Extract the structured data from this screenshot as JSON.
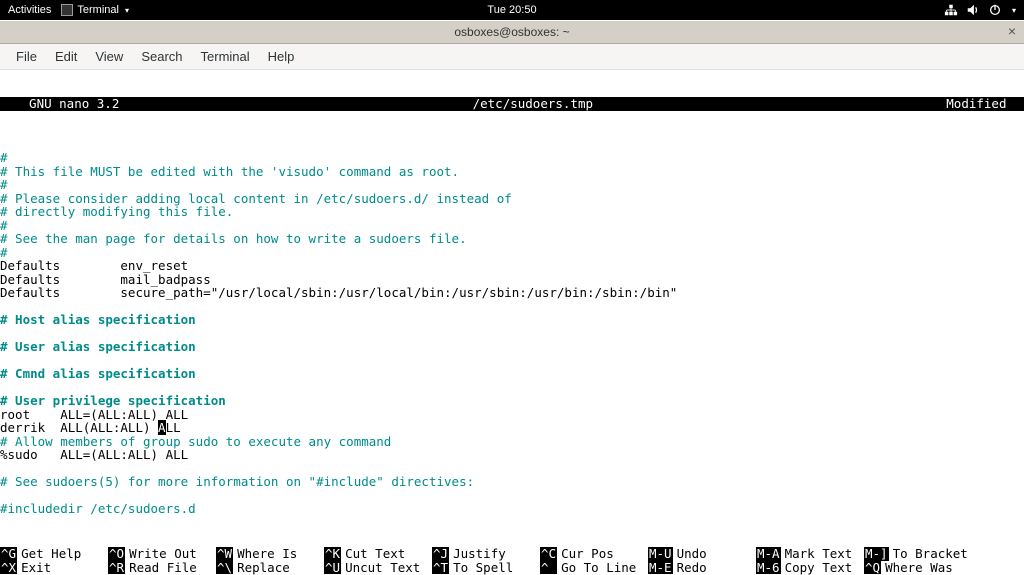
{
  "gnome": {
    "activities": "Activities",
    "app_name": "Terminal",
    "clock": "Tue 20:50"
  },
  "window": {
    "title": "osboxes@osboxes: ~",
    "close": "×"
  },
  "menu": {
    "file": "File",
    "edit": "Edit",
    "view": "View",
    "search": "Search",
    "terminal": "Terminal",
    "help": "Help"
  },
  "nano": {
    "version": "  GNU nano 3.2",
    "filepath": "/etc/sudoers.tmp",
    "modified": "Modified "
  },
  "editor": {
    "l1": "#",
    "l2": "# This file MUST be edited with the 'visudo' command as root.",
    "l3": "#",
    "l4": "# Please consider adding local content in /etc/sudoers.d/ instead of",
    "l5": "# directly modifying this file.",
    "l6": "#",
    "l7": "# See the man page for details on how to write a sudoers file.",
    "l8": "#",
    "l9": "Defaults        env_reset",
    "l10": "Defaults        mail_badpass",
    "l11": "Defaults        secure_path=\"/usr/local/sbin:/usr/local/bin:/usr/sbin:/usr/bin:/sbin:/bin\"",
    "l12": "# Host alias specification",
    "l13": "# User alias specification",
    "l14": "# Cmnd alias specification",
    "l15": "# User privilege specification",
    "l16": "root    ALL=(ALL:ALL) ALL",
    "l17a": "derrik  ALL(ALL:ALL) ",
    "l17b": "A",
    "l17c": "LL",
    "l18": "# Allow members of group sudo to execute any command",
    "l19": "%sudo   ALL=(ALL:ALL) ALL",
    "l20": "# See sudoers(5) for more information on \"#include\" directives:",
    "l21": "#includedir /etc/sudoers.d"
  },
  "shortcuts": {
    "r1": {
      "k1": "^G",
      "d1": "Get Help",
      "k2": "^O",
      "d2": "Write Out",
      "k3": "^W",
      "d3": "Where Is",
      "k4": "^K",
      "d4": "Cut Text",
      "k5": "^J",
      "d5": "Justify",
      "k6": "^C",
      "d6": "Cur Pos",
      "k7": "M-U",
      "d7": "Undo",
      "k8": "M-A",
      "d8": "Mark Text",
      "k9": "M-]",
      "d9": "To Bracket"
    },
    "r2": {
      "k1": "^X",
      "d1": "Exit",
      "k2": "^R",
      "d2": "Read File",
      "k3": "^\\",
      "d3": "Replace",
      "k4": "^U",
      "d4": "Uncut Text",
      "k5": "^T",
      "d5": "To Spell",
      "k6": "^_",
      "d6": "Go To Line",
      "k7": "M-E",
      "d7": "Redo",
      "k8": "M-6",
      "d8": "Copy Text",
      "k9": "^Q",
      "d9": "Where Was"
    }
  }
}
